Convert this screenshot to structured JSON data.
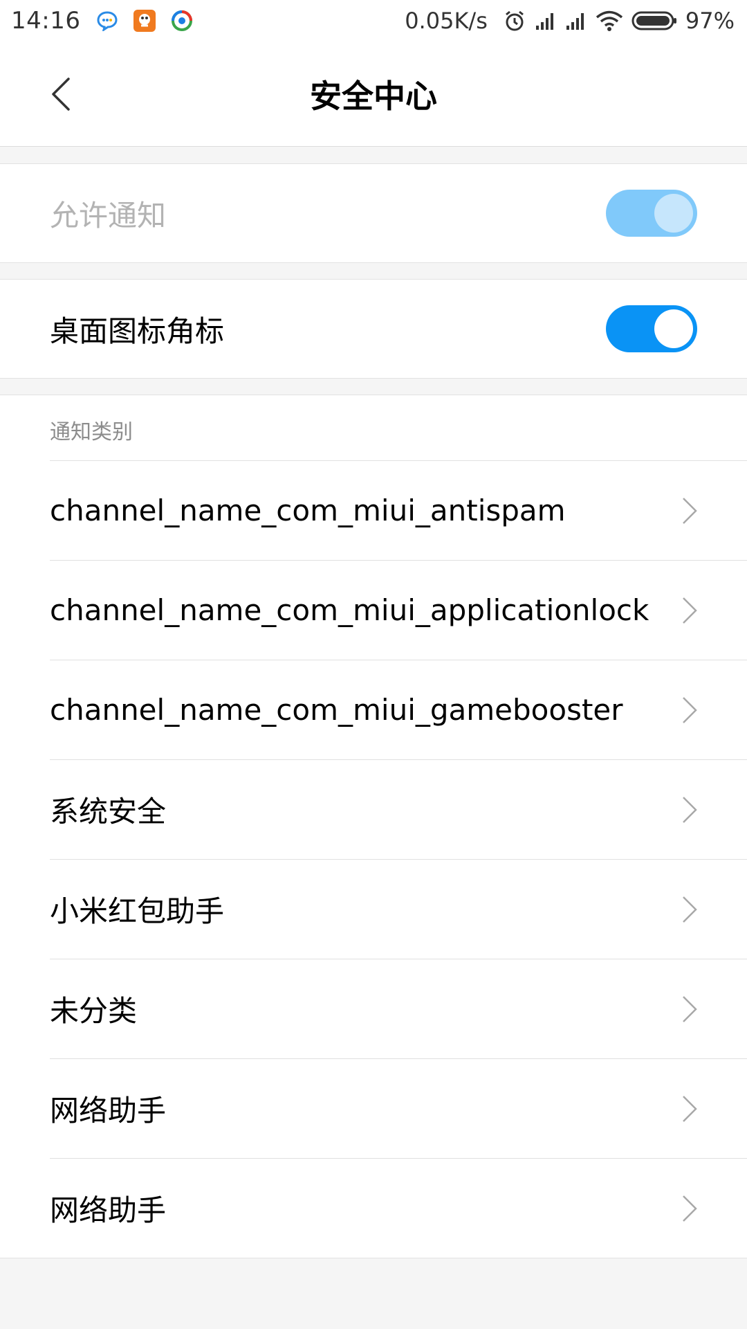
{
  "status_bar": {
    "time": "14:16",
    "apps": [
      "chat-bubble-icon",
      "game-app-icon",
      "browser-app-icon"
    ],
    "net_speed": "0.05K/s",
    "icons": [
      "alarm-icon",
      "signal-icon",
      "signal-icon",
      "wifi-icon",
      "battery-icon"
    ],
    "battery": "97%"
  },
  "header": {
    "title": "安全中心",
    "back_icon": "chevron-left-icon"
  },
  "settings": {
    "allow_notifications": {
      "label": "允许通知",
      "enabled": true,
      "disabled_state": true
    },
    "badge": {
      "label": "桌面图标角标",
      "enabled": true
    }
  },
  "categories": {
    "header": "通知类别",
    "items": [
      {
        "label": "channel_name_com_miui_antispam"
      },
      {
        "label": "channel_name_com_miui_applicationlock"
      },
      {
        "label": "channel_name_com_miui_gamebooster"
      },
      {
        "label": "系统安全"
      },
      {
        "label": "小米红包助手"
      },
      {
        "label": "未分类"
      },
      {
        "label": "网络助手"
      },
      {
        "label": "网络助手"
      }
    ]
  },
  "colors": {
    "accent": "#0a93f5",
    "accent_disabled": "#80c9fa",
    "knob_disabled": "#c6e6fc"
  }
}
